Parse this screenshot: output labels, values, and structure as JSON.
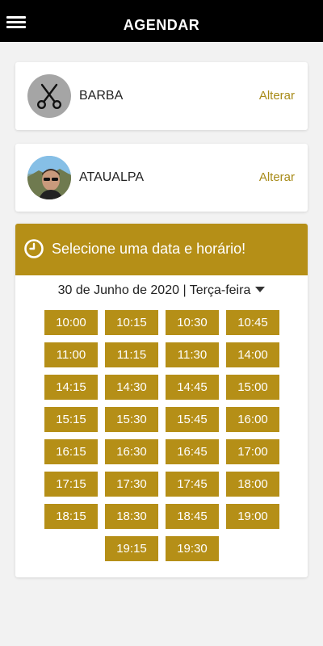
{
  "header": {
    "title": "AGENDAR"
  },
  "service": {
    "name": "BARBA",
    "action": "Alterar"
  },
  "professional": {
    "name": "ATAUALPA",
    "action": "Alterar"
  },
  "schedule": {
    "title": "Selecione uma data e horário!",
    "date": "30 de Junho de 2020 | Terça-feira",
    "slots": [
      "10:00",
      "10:15",
      "10:30",
      "10:45",
      "11:00",
      "11:15",
      "11:30",
      "14:00",
      "14:15",
      "14:30",
      "14:45",
      "15:00",
      "15:15",
      "15:30",
      "15:45",
      "16:00",
      "16:15",
      "16:30",
      "16:45",
      "17:00",
      "17:15",
      "17:30",
      "17:45",
      "18:00",
      "18:15",
      "18:30",
      "18:45",
      "19:00",
      "19:15",
      "19:30"
    ]
  },
  "colors": {
    "accent": "#b58f17",
    "link": "#a88b18",
    "topbar": "#000000",
    "background": "#f2f2f2"
  },
  "icons": {
    "menu": "hamburger-icon",
    "service": "scissors-icon",
    "clock": "clock-icon",
    "dropdown": "caret-down-icon"
  }
}
